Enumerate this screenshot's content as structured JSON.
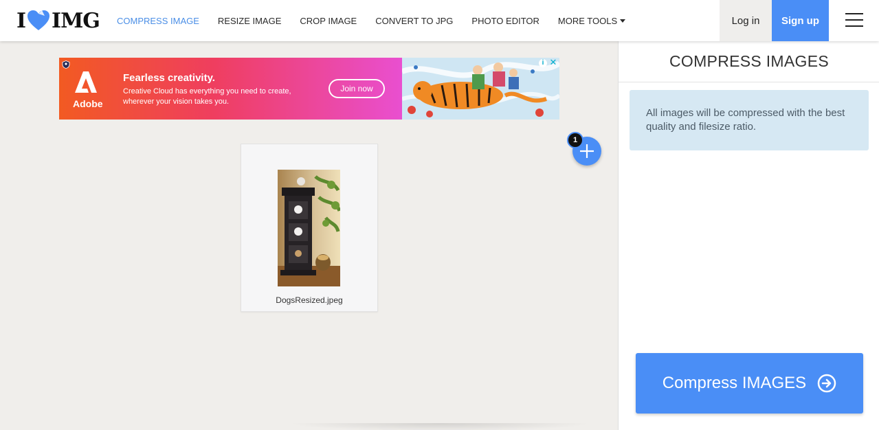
{
  "header": {
    "logo": {
      "left_text": "I",
      "right_text": "IMG",
      "icon": "heart-icon"
    },
    "nav": [
      {
        "label": "COMPRESS IMAGE",
        "active": true
      },
      {
        "label": "RESIZE IMAGE",
        "active": false
      },
      {
        "label": "CROP IMAGE",
        "active": false
      },
      {
        "label": "CONVERT TO JPG",
        "active": false
      },
      {
        "label": "PHOTO EDITOR",
        "active": false
      },
      {
        "label": "MORE TOOLS",
        "active": false,
        "icon": "caret-down-icon"
      }
    ],
    "login_label": "Log in",
    "signup_label": "Sign up",
    "menu_icon": "hamburger-icon"
  },
  "ad": {
    "brand": "Adobe",
    "title": "Fearless creativity.",
    "body": "Creative Cloud has everything you need to create, wherever your vision takes you.",
    "cta": "Join now",
    "info_icon": "info-icon",
    "close_icon": "close-icon"
  },
  "workspace": {
    "file_count": "1",
    "add_icon": "plus-icon",
    "files": [
      {
        "name": "DogsResized.jpeg"
      }
    ]
  },
  "sidebar": {
    "title": "COMPRESS IMAGES",
    "info": "All images will be compressed with the best quality and filesize ratio.",
    "action_label": "Compress IMAGES",
    "action_icon": "arrow-right-circle-icon"
  },
  "colors": {
    "accent": "#4a8ef6",
    "active_nav": "#4a8ee6",
    "info_box": "#d6e8f3",
    "logo_heart": "#4a8ef6"
  }
}
